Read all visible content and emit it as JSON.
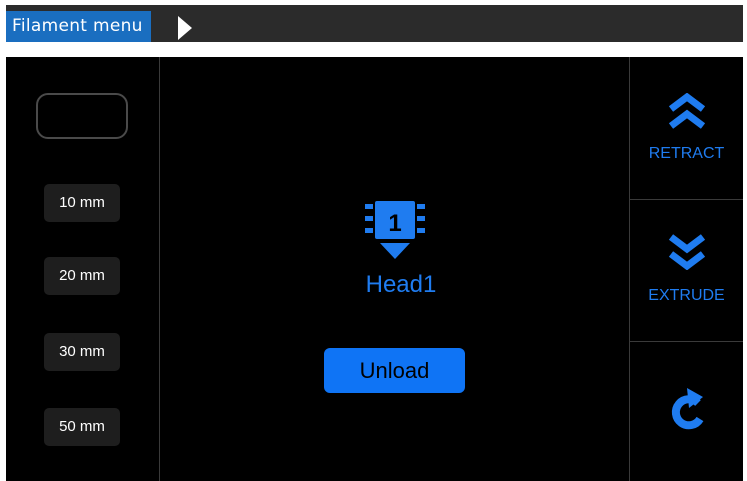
{
  "header": {
    "breadcrumb": "Filament menu"
  },
  "left": {
    "custom_value": "",
    "steps": [
      {
        "label": "10 mm"
      },
      {
        "label": "20 mm"
      },
      {
        "label": "30 mm"
      },
      {
        "label": "50 mm"
      }
    ]
  },
  "center": {
    "head_number": "1",
    "head_label": "Head1",
    "unload_label": "Unload"
  },
  "right": {
    "retract_label": "RETRACT",
    "extrude_label": "EXTRUDE",
    "back_icon": "refresh-icon"
  },
  "colors": {
    "accent": "#1f7cf0",
    "button_blue": "#0f74f5",
    "breadcrumb_bg": "#1a6ec0",
    "topbar_bg": "#2b2b2b",
    "screen_bg": "#000000"
  }
}
